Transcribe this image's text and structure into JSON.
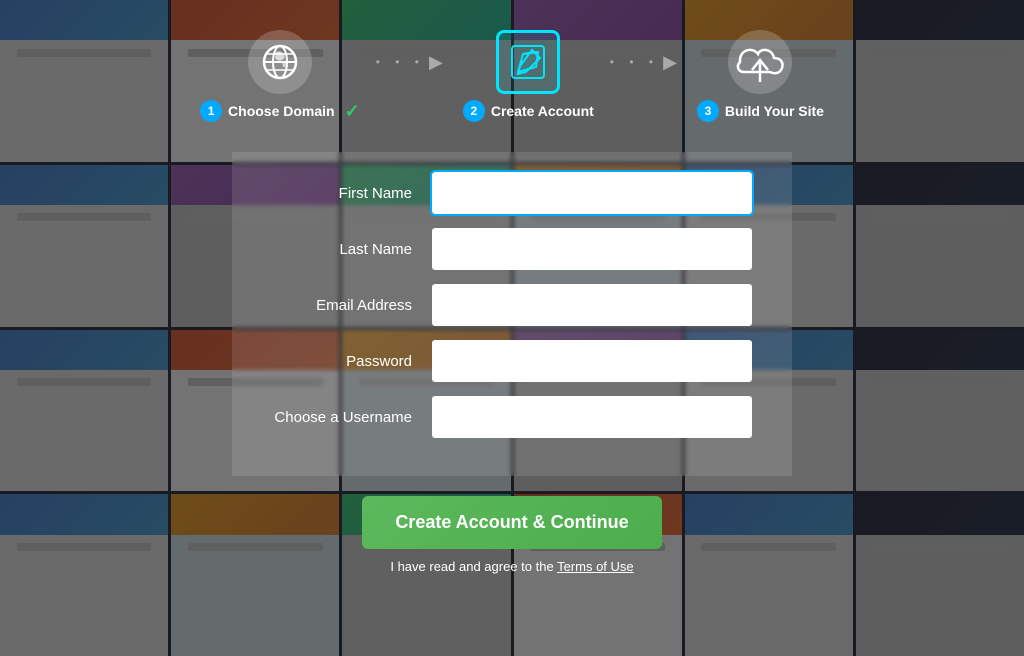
{
  "background": {
    "tile_count": 24
  },
  "steps": [
    {
      "number": "1",
      "label": "Choose Domain",
      "icon": "globe",
      "completed": true,
      "active": false
    },
    {
      "number": "2",
      "label": "Create Account",
      "icon": "pencil",
      "completed": false,
      "active": true
    },
    {
      "number": "3",
      "label": "Build Your Site",
      "icon": "cloud",
      "completed": false,
      "active": false
    }
  ],
  "divider": ".....",
  "form": {
    "fields": [
      {
        "id": "first-name",
        "label": "First Name",
        "type": "text",
        "placeholder": ""
      },
      {
        "id": "last-name",
        "label": "Last Name",
        "type": "text",
        "placeholder": ""
      },
      {
        "id": "email",
        "label": "Email Address",
        "type": "email",
        "placeholder": ""
      },
      {
        "id": "password",
        "label": "Password",
        "type": "password",
        "placeholder": ""
      },
      {
        "id": "username",
        "label": "Choose a Username",
        "type": "text",
        "placeholder": ""
      }
    ],
    "submit_label": "Create Account & Continue",
    "terms_text": "I have read and agree to the ",
    "terms_link_label": "Terms of Use"
  },
  "colors": {
    "accent_cyan": "#00e5ff",
    "accent_blue": "#00aaff",
    "accent_green": "#5cb85c",
    "step_active_border": "#00e5ff"
  }
}
